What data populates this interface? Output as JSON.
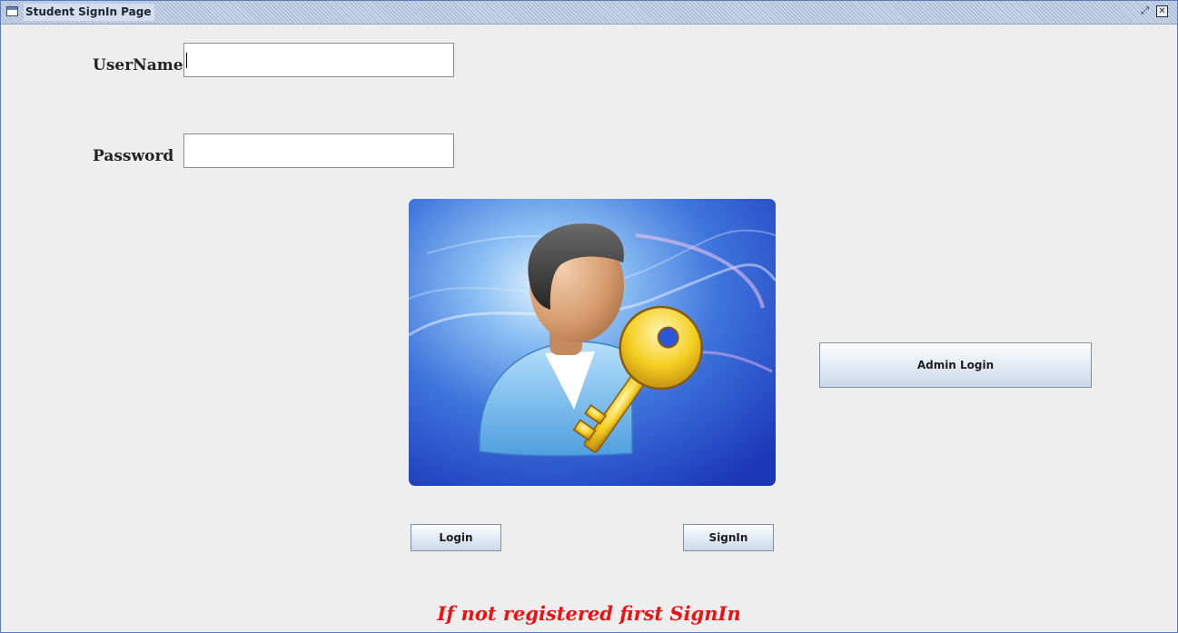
{
  "window": {
    "title": "Student SignIn Page",
    "icons": [
      "window-app-icon",
      "restore-icon",
      "close-icon"
    ],
    "restore_glyph": "⤢",
    "close_glyph": "✕"
  },
  "form": {
    "username_label": "UserName  :",
    "username_value": "",
    "password_label": "Password  :",
    "password_value": ""
  },
  "image": {
    "icon": "user-with-key-icon"
  },
  "buttons": {
    "login": "Login",
    "signin": "SignIn",
    "admin_login": "Admin Login"
  },
  "footer": {
    "message": "If not registered first SignIn"
  },
  "colors": {
    "background": "#eeeeee",
    "title_bar": "#c9d6ea",
    "footer_text": "#ee1111",
    "hero_blue": "#2a55d6",
    "key_gold": "#f2c318"
  }
}
